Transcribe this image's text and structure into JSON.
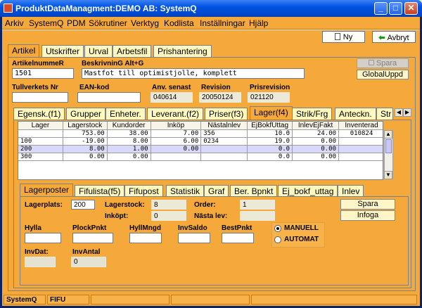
{
  "window": {
    "title": "ProduktDataManagment:DEMO AB: SystemQ",
    "minimize": "_",
    "maximize": "□",
    "close": "✕"
  },
  "menu": [
    "Arkiv",
    "SystemQ",
    "PDM",
    "Sökrutiner",
    "Verktyg",
    "Kodlista",
    "Inställningar",
    "Hjälp"
  ],
  "toolbar": {
    "new_label": "Ny",
    "cancel_label": "Avbryt"
  },
  "top_tabs": [
    "Artikel",
    "Utskrifter",
    "Urval",
    "Arbetsfil",
    "Prishantering"
  ],
  "article": {
    "nr_label": "ArtikelnummeR",
    "nr_value": "1501",
    "desc_label": "BeskrivninG Alt+G",
    "desc_value": "Mastfot till optimistjolle, komplett",
    "save_label": "Spara",
    "global_label": "GlobalUppd",
    "tullverkets_label": "Tullverkets Nr",
    "tullverkets_value": "",
    "ean_label": "EAN-kod",
    "ean_value": "",
    "anv_label": "Anv. senast",
    "anv_value": "040614",
    "rev_label": "Revision",
    "rev_value": "20050124",
    "prisrev_label": "Prisrevision",
    "prisrev_value": "021120"
  },
  "mid_tabs": [
    "Egensk.(f1)",
    "Grupper",
    "Enheter.",
    "Leverant.(f2)",
    "Priser(f3)",
    "Lager(f4)",
    "Strik/Frg",
    "Anteckn.",
    "Str"
  ],
  "stock_table": {
    "headers": [
      "Lager",
      "Lagerstock",
      "Kundorder",
      "Inköp",
      "Nästalnlev",
      "EjBokfUttag",
      "InlevEjFakt",
      "Inventerad"
    ],
    "rows": [
      [
        "",
        "753.00",
        "38.00",
        "7.00",
        "356",
        "10.0",
        "24.00",
        "010824"
      ],
      [
        "100",
        "-19.00",
        "8.00",
        "6.00",
        "0234",
        "19.0",
        "0.00",
        ""
      ],
      [
        "200",
        "8.00",
        "1.00",
        "0.00",
        "",
        "0.0",
        "0.00",
        ""
      ],
      [
        "300",
        "0.00",
        "0.00",
        "",
        "",
        "0.0",
        "0.00",
        ""
      ]
    ]
  },
  "sub_tabs": [
    "Lagerposter",
    "Fifulista(f5)",
    "Fifupost",
    "Statistik",
    "Graf",
    "Ber. Bpnkt",
    "Ej_bokf_uttag",
    "Inlev"
  ],
  "lager": {
    "lagerplats_label": "Lagerplats:",
    "lagerplats_value": "200",
    "lagerstock_label": "Lagerstock:",
    "lagerstock_value": "8",
    "inkopt_label": "Inköpt:",
    "inkopt_value": "0",
    "order_label": "Order:",
    "order_value": "1",
    "nasta_label": "Nästa lev:",
    "nasta_value": "",
    "spara_label": "Spara",
    "infoga_label": "Infoga",
    "hylla_label": "Hylla",
    "plock_label": "PlockPnkt",
    "hyllm_label": "HyllMngd",
    "invsaldo_label": "InvSaldo",
    "bestp_label": "BestPnkt",
    "manuell_label": "MANUELL",
    "automat_label": "AUTOMAT",
    "invdat_label": "InvDat:",
    "invantal_label": "InvAntal",
    "invantal_value": "0"
  },
  "status": [
    "SystemQ",
    "FIFU",
    "",
    "",
    ""
  ]
}
